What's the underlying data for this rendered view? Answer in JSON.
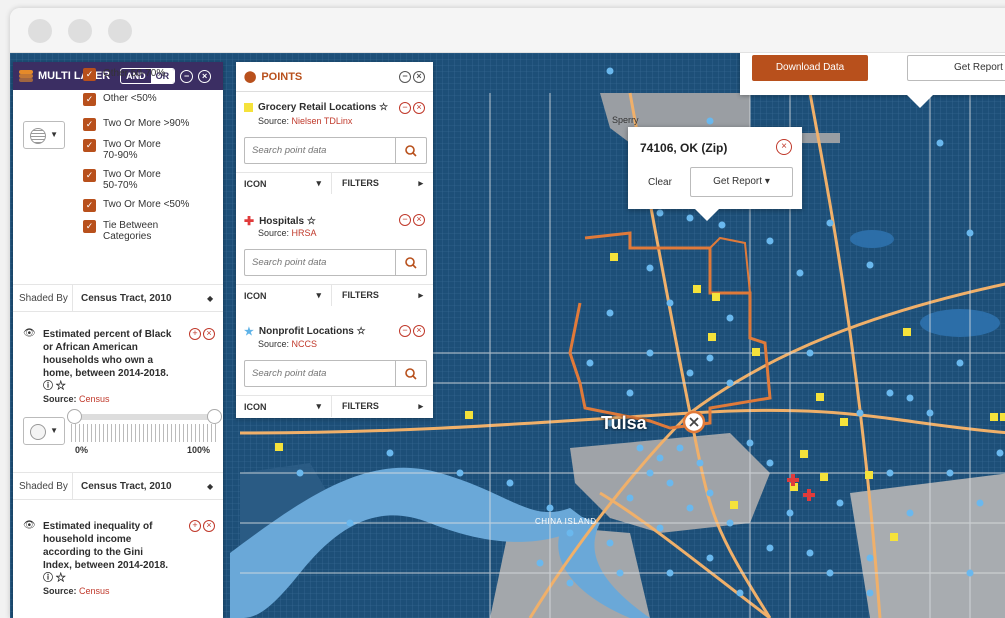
{
  "multi_layer": {
    "title": "MULTI LAYER",
    "toggle": {
      "and": "AND",
      "or": "OR"
    },
    "legend": [
      "Other 50-70%",
      "Other <50%",
      "Two Or More >90%",
      "Two Or More 70-90%",
      "Two Or More 50-70%",
      "Two Or More <50%",
      "Tie Between Categories"
    ],
    "shaded_by_label": "Shaded By",
    "shaded_by_1": "Census Tract, 2010",
    "layer1": {
      "title": "Estimated percent of Black or African American households who own a home, between 2014-2018.",
      "source_label": "Source:",
      "source": "Census"
    },
    "slider_min": "0%",
    "slider_max": "100%",
    "shaded_by_2": "Census Tract, 2010",
    "layer2": {
      "title": "Estimated inequality of household income according to the Gini Index, between 2014-2018.",
      "source_label": "Source:",
      "source": "Census"
    }
  },
  "points": {
    "title": "POINTS",
    "search_placeholder": "Search point data",
    "icon_label": "ICON",
    "filters_label": "FILTERS",
    "source_label": "Source:",
    "layers": [
      {
        "name": "Grocery Retail Locations",
        "source": "Nielsen TDLinx",
        "color": "#f5e23b"
      },
      {
        "name": "Hospitals",
        "source": "HRSA",
        "color": "#e03b3b"
      },
      {
        "name": "Nonprofit Locations",
        "source": "NCCS",
        "color": "#5fb3e8"
      }
    ]
  },
  "toolbar": {
    "download": "Download Data",
    "get_report": "Get Report"
  },
  "popup": {
    "title": "74106, OK (Zip)",
    "clear": "Clear",
    "get_report": "Get Report"
  },
  "map": {
    "city_tulsa": "Tulsa",
    "city_sperry": "Sperry",
    "city_island": "CHINA ISLAND"
  },
  "colors": {
    "brand": "#b8501c",
    "header": "#3b2e63",
    "map_blue": "#1d4f78",
    "highlight": "#e07a3a"
  }
}
